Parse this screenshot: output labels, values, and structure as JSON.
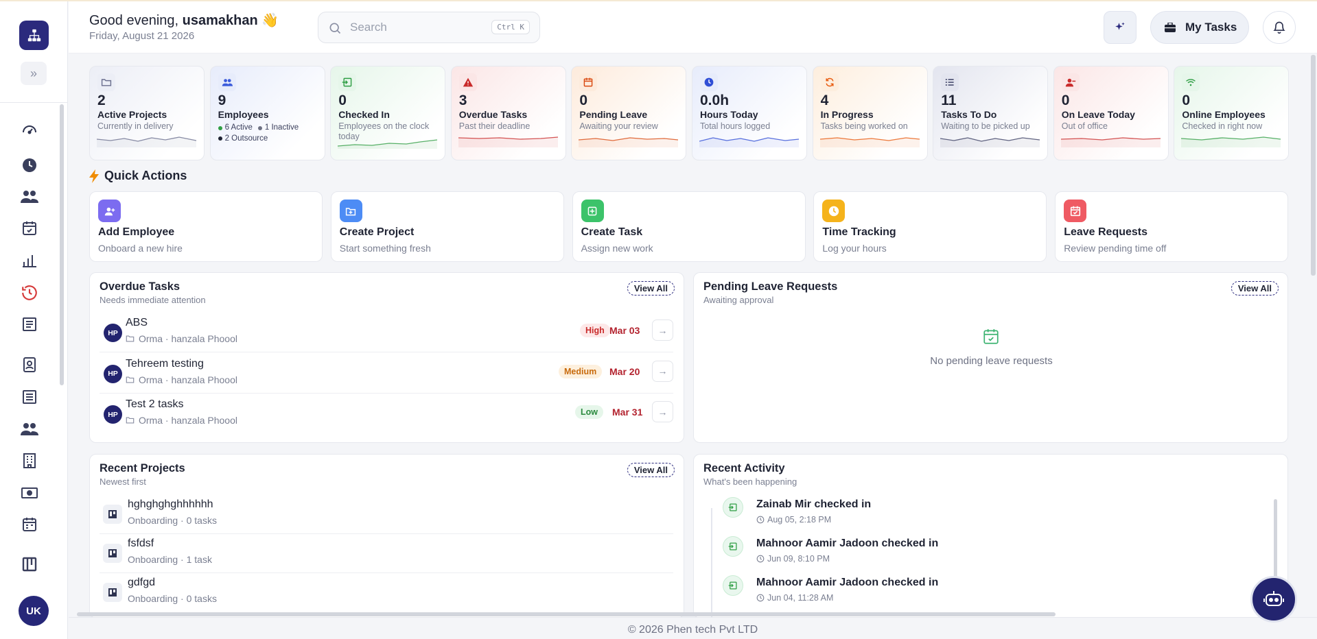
{
  "header": {
    "greeting_prefix": "Good evening,",
    "user_name": "usamakhan",
    "wave_emoji": "👋",
    "date": "Friday, August 21 2026",
    "search_placeholder": "Search",
    "search_shortcut": "Ctrl K",
    "my_tasks_label": "My Tasks"
  },
  "sidebar": {
    "avatar_initials": "UK",
    "nav_icons": [
      "dashboard-gauge-icon",
      "clock-icon",
      "team-icon",
      "calendar-check-icon",
      "bar-chart-icon",
      "time-history-icon",
      "report-icon",
      "contact-card-icon",
      "document-list-icon",
      "users-icon",
      "building-icon",
      "money-icon",
      "calendar-icon",
      "kanban-icon"
    ]
  },
  "stats": [
    {
      "value": "2",
      "label": "Active Projects",
      "sub": "Currently in delivery",
      "icon": "folder-icon",
      "color": "#6b6f8e",
      "bg": "#eceef6"
    },
    {
      "value": "9",
      "label": "Employees",
      "sub": "",
      "icon": "users-icon",
      "color": "#3b5bdb",
      "bg": "#e7ecfb",
      "legend": [
        "6 Active",
        "1 Inactive",
        "2 Outsource"
      ]
    },
    {
      "value": "0",
      "label": "Checked In",
      "sub": "Employees on the clock today",
      "icon": "login-icon",
      "color": "#2f9e44",
      "bg": "#e6f6ea"
    },
    {
      "value": "3",
      "label": "Overdue Tasks",
      "sub": "Past their deadline",
      "icon": "warning-icon",
      "color": "#c92a2a",
      "bg": "#fbe6e6"
    },
    {
      "value": "0",
      "label": "Pending Leave",
      "sub": "Awaiting your review",
      "icon": "calendar-icon",
      "color": "#d9480f",
      "bg": "#fdebdc"
    },
    {
      "value": "0.0h",
      "label": "Hours Today",
      "sub": "Total hours logged",
      "icon": "clock-icon",
      "color": "#2f4ed6",
      "bg": "#e7ecfb"
    },
    {
      "value": "4",
      "label": "In Progress",
      "sub": "Tasks being worked on",
      "icon": "refresh-icon",
      "color": "#e8590c",
      "bg": "#fdeede"
    },
    {
      "value": "11",
      "label": "Tasks To Do",
      "sub": "Waiting to be picked up",
      "icon": "list-icon",
      "color": "#3b3f63",
      "bg": "#e3e5ef"
    },
    {
      "value": "0",
      "label": "On Leave Today",
      "sub": "Out of office",
      "icon": "user-minus-icon",
      "color": "#c92a2a",
      "bg": "#fbe6e6"
    },
    {
      "value": "0",
      "label": "Online Employees",
      "sub": "Checked in right now",
      "icon": "wifi-icon",
      "color": "#2f9e44",
      "bg": "#e6f6ea"
    }
  ],
  "quick_actions": {
    "title": "Quick Actions",
    "items": [
      {
        "title": "Add Employee",
        "desc": "Onboard a new hire",
        "color": "#7c6cf0",
        "icon": "user-plus-icon"
      },
      {
        "title": "Create Project",
        "desc": "Start something fresh",
        "color": "#4d8cf5",
        "icon": "folder-plus-icon"
      },
      {
        "title": "Create Task",
        "desc": "Assign new work",
        "color": "#3cc36a",
        "icon": "plus-square-icon"
      },
      {
        "title": "Time Tracking",
        "desc": "Log your hours",
        "color": "#f5b31b",
        "icon": "clock-icon"
      },
      {
        "title": "Leave Requests",
        "desc": "Review pending time off",
        "color": "#ef5a63",
        "icon": "calendar-icon"
      }
    ]
  },
  "overdue": {
    "title": "Overdue Tasks",
    "subtitle": "Needs immediate attention",
    "view_all": "View All",
    "rows": [
      {
        "initials": "HP",
        "name": "ABS",
        "meta": "Orma · hanzala Phoool",
        "priority": "High",
        "due": "Mar 03"
      },
      {
        "initials": "HP",
        "name": "Tehreem testing",
        "meta": "Orma · hanzala Phoool",
        "priority": "Medium",
        "due": "Mar 20"
      },
      {
        "initials": "HP",
        "name": "Test 2 tasks",
        "meta": "Orma · hanzala Phoool",
        "priority": "Low",
        "due": "Mar 31"
      }
    ]
  },
  "leave": {
    "title": "Pending Leave Requests",
    "subtitle": "Awaiting approval",
    "view_all": "View All",
    "empty": "No pending leave requests"
  },
  "projects": {
    "title": "Recent Projects",
    "subtitle": "Newest first",
    "view_all": "View All",
    "rows": [
      {
        "name": "hghghghghhhhhh",
        "meta": "Onboarding · 0 tasks"
      },
      {
        "name": "fsfdsf",
        "meta": "Onboarding · 1 task"
      },
      {
        "name": "gdfgd",
        "meta": "Onboarding · 0 tasks"
      }
    ]
  },
  "activity": {
    "title": "Recent Activity",
    "subtitle": "What's been happening",
    "rows": [
      {
        "text": "Zainab Mir checked in",
        "time": "Aug 05, 2:18 PM"
      },
      {
        "text": "Mahnoor Aamir Jadoon checked in",
        "time": "Jun 09, 8:10 PM"
      },
      {
        "text": "Mahnoor Aamir Jadoon checked in",
        "time": "Jun 04, 11:28 AM"
      }
    ]
  },
  "footer": "© 2026 Phen tech Pvt LTD"
}
